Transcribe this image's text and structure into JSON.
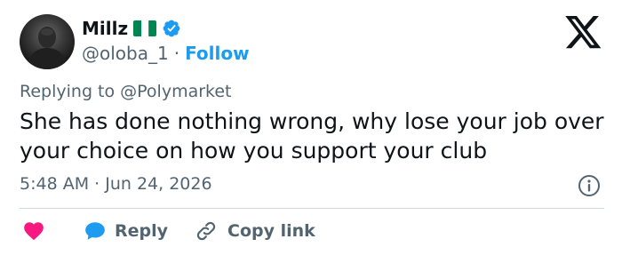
{
  "author": {
    "display_name": "Millz",
    "handle": "@oloba_1",
    "separator": "·",
    "follow_label": "Follow",
    "flag": "nigeria-flag",
    "verified": true
  },
  "reply_context": "Replying to @Polymarket",
  "tweet": {
    "text": "She has done nothing wrong, why lose your job over your choice on how you support your club",
    "timestamp": "5:48 AM · Jun 24, 2026"
  },
  "actions": {
    "like_icon": "heart-icon",
    "reply_label": "Reply",
    "copy_link_label": "Copy link"
  },
  "colors": {
    "text": "#0f1419",
    "muted": "#536471",
    "accent": "#1d9bf0",
    "like": "#f91880",
    "divider": "#cfd9de",
    "flag_green": "#008751"
  }
}
